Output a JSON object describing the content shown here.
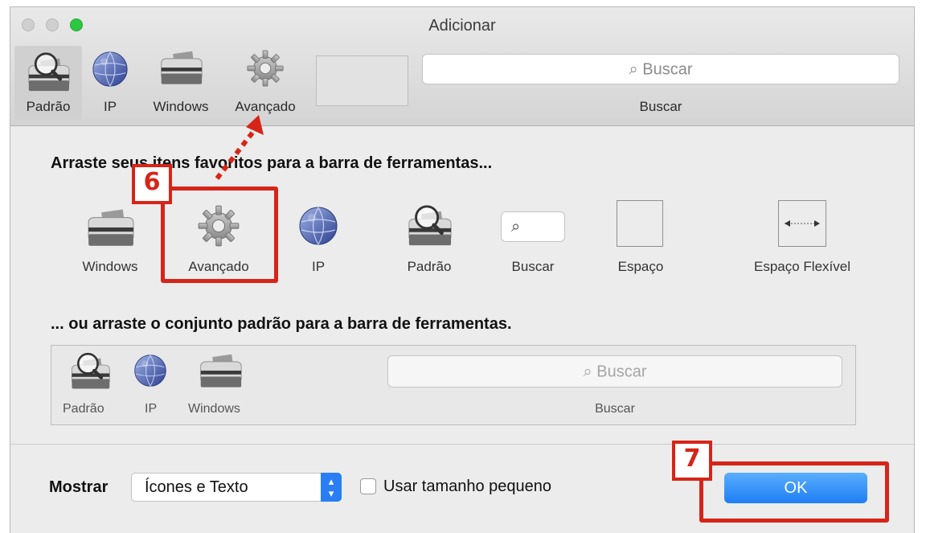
{
  "window": {
    "title": "Adicionar"
  },
  "toolbar": {
    "items": [
      {
        "label": "Padrão",
        "icon": "magnifier-printer-icon",
        "selected": true
      },
      {
        "label": "IP",
        "icon": "globe-icon",
        "selected": false
      },
      {
        "label": "Windows",
        "icon": "printer-icon",
        "selected": false
      },
      {
        "label": "Avançado",
        "icon": "gear-icon",
        "selected": false
      }
    ],
    "search": {
      "placeholder": "Buscar",
      "label": "Buscar"
    }
  },
  "palette": {
    "heading": "Arraste seus itens favoritos para a barra de ferramentas...",
    "items": [
      {
        "label": "Windows",
        "icon": "printer-icon"
      },
      {
        "label": "Avançado",
        "icon": "gear-icon"
      },
      {
        "label": "IP",
        "icon": "globe-icon"
      },
      {
        "label": "Padrão",
        "icon": "magnifier-printer-icon"
      },
      {
        "label": "Buscar",
        "icon": "search-field-icon"
      },
      {
        "label": "Espaço",
        "icon": "space-icon"
      },
      {
        "label": "Espaço Flexível",
        "icon": "flexible-space-icon"
      }
    ]
  },
  "default_set": {
    "heading": "... ou arraste o conjunto padrão para a barra de ferramentas.",
    "items": [
      {
        "label": "Padrão",
        "icon": "magnifier-printer-icon"
      },
      {
        "label": "IP",
        "icon": "globe-icon"
      },
      {
        "label": "Windows",
        "icon": "printer-icon"
      }
    ],
    "search": {
      "placeholder": "Buscar",
      "label": "Buscar"
    }
  },
  "footer": {
    "show_label": "Mostrar",
    "show_value": "Ícones e Texto",
    "small_size_label": "Usar tamanho pequeno",
    "small_size_checked": false,
    "ok_label": "OK"
  },
  "annotations": {
    "step6": "6",
    "step7": "7"
  },
  "colors": {
    "annotation": "#d62518",
    "accent": "#1f7ef5",
    "maximize": "#2cc840"
  }
}
